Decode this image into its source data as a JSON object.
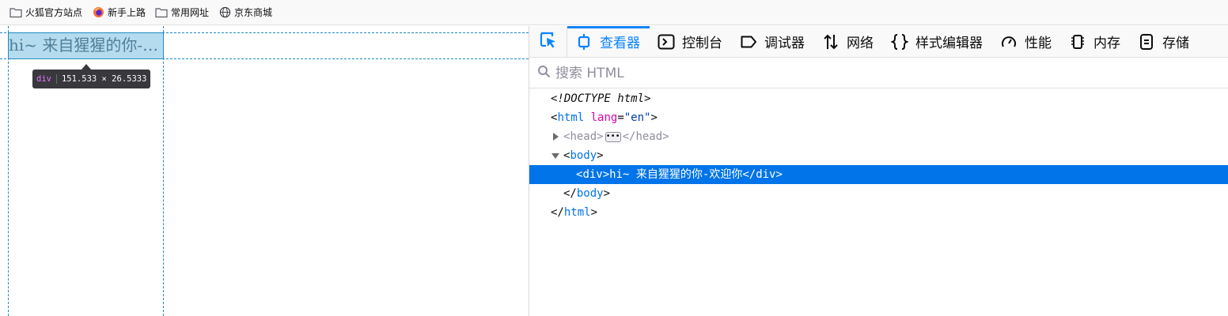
{
  "bookmarks": [
    {
      "label": "火狐官方站点",
      "icon": "folder-icon"
    },
    {
      "label": "新手上路",
      "icon": "firefox-icon"
    },
    {
      "label": "常用网址",
      "icon": "folder-icon"
    },
    {
      "label": "京东商城",
      "icon": "globe-icon"
    }
  ],
  "page": {
    "div_text": "hi~ 来自猩猩的你-…",
    "infobar": {
      "tag": "div",
      "size": "151.533 × 26.5333"
    }
  },
  "devtools": {
    "tabs": [
      {
        "label": "查看器",
        "icon": "inspector-icon",
        "selected": true
      },
      {
        "label": "控制台",
        "icon": "console-icon",
        "selected": false
      },
      {
        "label": "调试器",
        "icon": "debugger-icon",
        "selected": false
      },
      {
        "label": "网络",
        "icon": "network-icon",
        "selected": false
      },
      {
        "label": "样式编辑器",
        "icon": "style-editor-icon",
        "selected": false
      },
      {
        "label": "性能",
        "icon": "performance-icon",
        "selected": false
      },
      {
        "label": "内存",
        "icon": "memory-icon",
        "selected": false
      },
      {
        "label": "存储",
        "icon": "storage-icon",
        "selected": false
      }
    ],
    "search_placeholder": "搜索 HTML",
    "tree": {
      "doctype": "<!DOCTYPE html>",
      "html_open_tag": "html",
      "html_attr_name": "lang",
      "html_attr_value": "\"en\"",
      "head_tag": "head",
      "body_tag": "body",
      "div_tag": "div",
      "div_text": "hi~ 来自猩猩的你-欢迎你",
      "selected_node": "div"
    }
  },
  "colors": {
    "accent": "#0a84ff",
    "selection": "#0074e8",
    "guide": "#1d8bc2",
    "tag_name": "#0074e8",
    "attr_name": "#dd00a9",
    "attr_value": "#003eaa"
  }
}
